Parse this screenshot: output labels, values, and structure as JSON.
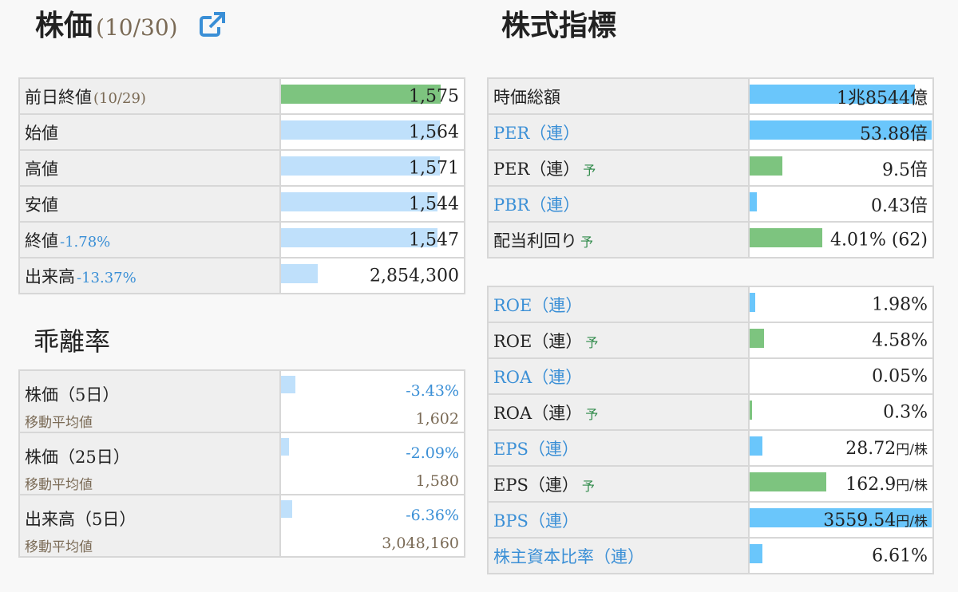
{
  "stock": {
    "title": "株価",
    "date": "(10/30)",
    "rows": [
      {
        "label": "前日終値",
        "suffix": "(10/29)",
        "value": "1,575",
        "bar": 1.0,
        "color": "green"
      },
      {
        "label": "始値",
        "suffix": "",
        "value": "1,564",
        "bar": 0.993,
        "color": "blue"
      },
      {
        "label": "高値",
        "suffix": "",
        "value": "1,571",
        "bar": 0.997,
        "color": "blue"
      },
      {
        "label": "安値",
        "suffix": "",
        "value": "1,544",
        "bar": 0.98,
        "color": "blue"
      },
      {
        "label": "終値",
        "pct": "-1.78%",
        "value": "1,547",
        "bar": 0.982,
        "color": "blue"
      },
      {
        "label": "出来高",
        "pct": "-13.37%",
        "value": "2,854,300",
        "bar": 0.23,
        "color": "blue"
      }
    ]
  },
  "kairi": {
    "title": "乖離率",
    "rows": [
      {
        "label": "株価（5日）",
        "sub": "移動平均値",
        "pct": "-3.43%",
        "value": "1,602",
        "bar": 0.09
      },
      {
        "label": "株価（25日）",
        "sub": "移動平均値",
        "pct": "-2.09%",
        "value": "1,580",
        "bar": 0.05
      },
      {
        "label": "出来高（5日）",
        "sub": "移動平均値",
        "pct": "-6.36%",
        "value": "3,048,160",
        "bar": 0.07
      }
    ]
  },
  "indicators": {
    "title": "株式指標",
    "yo": "予",
    "group1": [
      {
        "label": "時価総額",
        "link": false,
        "yo": false,
        "value": "1兆8544億",
        "unit": "",
        "bar": 0.91,
        "color": "sky"
      },
      {
        "label": "PER（連）",
        "link": true,
        "yo": false,
        "value": "53.88倍",
        "unit": "",
        "bar": 1.0,
        "color": "sky"
      },
      {
        "label": "PER（連）",
        "link": false,
        "yo": true,
        "value": "9.5倍",
        "unit": "",
        "bar": 0.18,
        "color": "green"
      },
      {
        "label": "PBR（連）",
        "link": true,
        "yo": false,
        "value": "0.43倍",
        "unit": "",
        "bar": 0.04,
        "color": "sky"
      },
      {
        "label": "配当利回り",
        "link": false,
        "yo": true,
        "value": "4.01% (62)",
        "unit": "",
        "bar": 0.4,
        "color": "green"
      }
    ],
    "group2": [
      {
        "label": "ROE（連）",
        "link": true,
        "yo": false,
        "value": "1.98%",
        "unit": "",
        "bar": 0.03,
        "color": "sky"
      },
      {
        "label": "ROE（連）",
        "link": false,
        "yo": true,
        "value": "4.58%",
        "unit": "",
        "bar": 0.08,
        "color": "green"
      },
      {
        "label": "ROA（連）",
        "link": true,
        "yo": false,
        "value": "0.05%",
        "unit": "",
        "bar": 0.0,
        "color": "sky"
      },
      {
        "label": "ROA（連）",
        "link": false,
        "yo": true,
        "value": "0.3%",
        "unit": "",
        "bar": 0.01,
        "color": "green"
      },
      {
        "label": "EPS（連）",
        "link": true,
        "yo": false,
        "value": "28.72",
        "unit": "円/株",
        "bar": 0.07,
        "color": "sky"
      },
      {
        "label": "EPS（連）",
        "link": false,
        "yo": true,
        "value": "162.9",
        "unit": "円/株",
        "bar": 0.42,
        "color": "green"
      },
      {
        "label": "BPS（連）",
        "link": true,
        "yo": false,
        "value": "3559.54",
        "unit": "円/株",
        "bar": 1.0,
        "color": "sky"
      },
      {
        "label": "株主資本比率（連）",
        "link": true,
        "yo": false,
        "value": "6.61%",
        "unit": "",
        "bar": 0.07,
        "color": "sky"
      }
    ]
  },
  "colors": {
    "green": "#7dc47f",
    "blue": "#bfe0fb",
    "sky": "#6ac6fb",
    "link": "#3a8fd6"
  }
}
